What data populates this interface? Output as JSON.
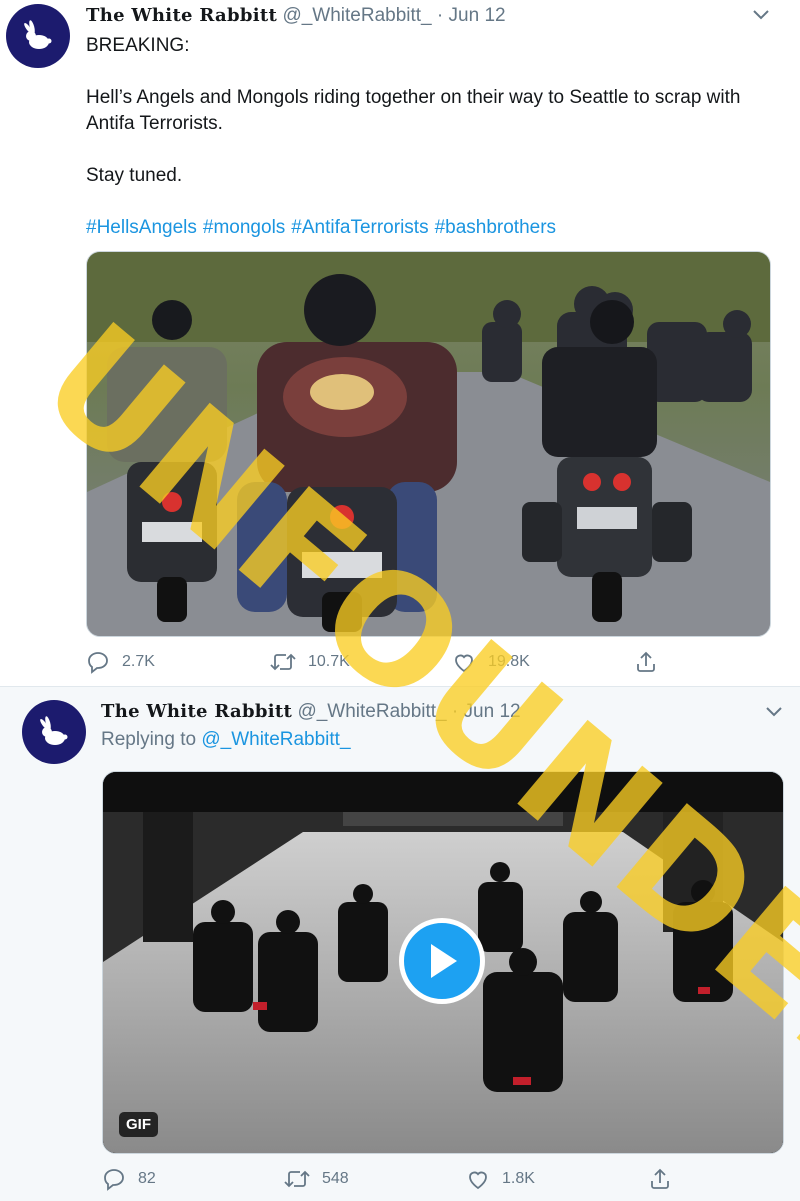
{
  "tweet1": {
    "author_name": "The White Rabbitt",
    "handle": "@_WhiteRabbitt_",
    "separator": "·",
    "date": "Jun 12",
    "text_line1": "BREAKING:",
    "text_line2": "Hell’s Angels and Mongols riding together on their way to Seattle to scrap with Antifa Terrorists.",
    "text_line3": "Stay tuned.",
    "hashtags": [
      "#HellsAngels",
      "#mongols",
      "#AntifaTerrorists",
      "#bashbrothers"
    ],
    "actions": {
      "reply_count": "2.7K",
      "retweet_count": "10.7K",
      "like_count": "19.8K"
    }
  },
  "tweet2": {
    "author_name": "The White Rabbitt",
    "handle": "@_WhiteRabbitt_",
    "separator": "·",
    "date": "Jun 12",
    "replying_prefix": "Replying to",
    "replying_to": "@_WhiteRabbitt_",
    "gif_label": "GIF",
    "actions": {
      "reply_count": "82",
      "retweet_count": "548",
      "like_count": "1.8K"
    }
  },
  "overlay": {
    "stamp_text": "UNFOUNDED"
  },
  "icons": {
    "avatar": "rabbit-icon",
    "menu": "chevron-down-icon",
    "reply": "reply-icon",
    "retweet": "retweet-icon",
    "like": "heart-icon",
    "share": "share-icon",
    "play": "play-icon"
  },
  "colors": {
    "link": "#1b95e0",
    "muted": "#657786",
    "avatar_bg": "#1c1b6e",
    "play_button": "#1da1f2",
    "stamp": "#facd23"
  }
}
